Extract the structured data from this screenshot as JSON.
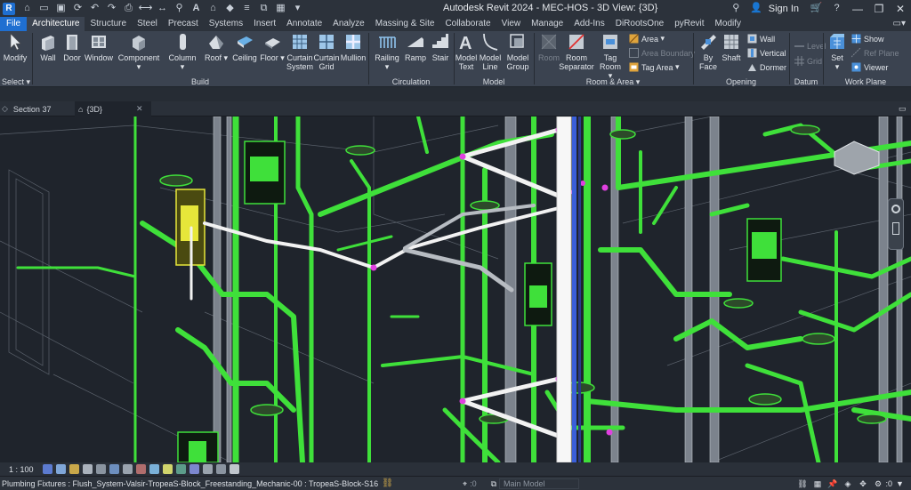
{
  "window": {
    "title": "Autodesk Revit 2024 - MEC-HOS - 3D View: {3D}",
    "sign_in": "Sign In"
  },
  "ribbon_tabs": [
    "File",
    "Architecture",
    "Structure",
    "Steel",
    "Precast",
    "Systems",
    "Insert",
    "Annotate",
    "Analyze",
    "Massing & Site",
    "Collaborate",
    "View",
    "Manage",
    "Add-Ins",
    "DiRootsOne",
    "pyRevit",
    "Modify"
  ],
  "ribbon": {
    "modify": "Modify",
    "select": "Select",
    "build": {
      "title": "Build",
      "wall": "Wall",
      "door": "Door",
      "window": "Window",
      "component": "Component",
      "column": "Column",
      "roof": "Roof",
      "ceiling": "Ceiling",
      "floor": "Floor",
      "curtain_system": [
        "Curtain",
        "System"
      ],
      "curtain_grid": [
        "Curtain",
        "Grid"
      ],
      "mullion": "Mullion"
    },
    "circulation": {
      "title": "Circulation",
      "railing": "Railing",
      "ramp": "Ramp",
      "stair": "Stair"
    },
    "model": {
      "title": "Model",
      "model_text": [
        "Model",
        "Text"
      ],
      "model_line": [
        "Model",
        "Line"
      ],
      "model_group": [
        "Model",
        "Group"
      ]
    },
    "room_area": {
      "title": "Room & Area",
      "room": "Room",
      "room_separator": [
        "Room",
        "Separator"
      ],
      "tag_room": [
        "Tag",
        "Room"
      ],
      "area": "Area",
      "area_boundary": "Area  Boundary",
      "tag_area": "Tag  Area"
    },
    "opening": {
      "title": "Opening",
      "by_face": [
        "By",
        "Face"
      ],
      "shaft": "Shaft",
      "wall": "Wall",
      "vertical": "Vertical",
      "dormer": "Dormer"
    },
    "datum": {
      "title": "Datum",
      "level": "Level",
      "grid": "Grid"
    },
    "work_plane": {
      "title": "Work Plane",
      "set": "Set",
      "show": "Show",
      "ref_plane": "Ref  Plane",
      "viewer": "Viewer"
    }
  },
  "view_tabs": [
    {
      "label": "Section 37",
      "active": false
    },
    {
      "label": "{3D}",
      "active": true
    }
  ],
  "view_control": {
    "scale": "1 : 100"
  },
  "status": {
    "selection": "Plumbing Fixtures : Flush_System-Valsir-TropeaS-Block_Freestanding_Mechanic-00 : TropeaS-Block-S16",
    "worksets": ":0",
    "model": "Main Model",
    "filter_count": ":0"
  },
  "colors": {
    "accent": "#1f6fd1",
    "background": "#1f242c",
    "pipe_green": "#3fe03a",
    "pipe_magenta": "#e040e0",
    "pipe_white": "#f2f2f2"
  }
}
